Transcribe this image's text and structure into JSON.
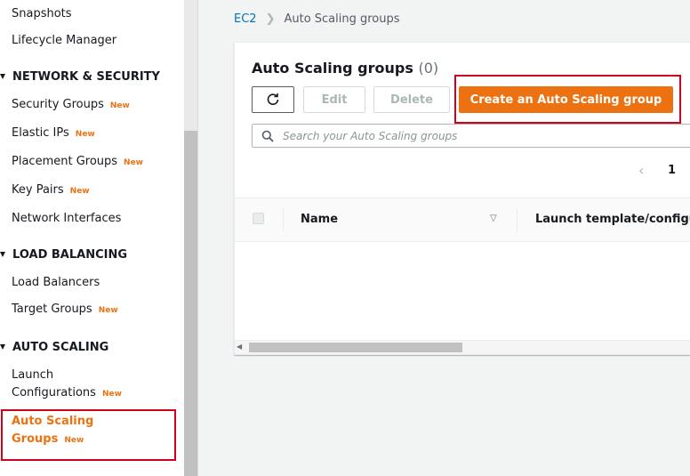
{
  "sidebar": {
    "items_top": [
      {
        "label": "Snapshots"
      },
      {
        "label": "Lifecycle Manager"
      }
    ],
    "network_section": "NETWORK & SECURITY",
    "network_items": [
      {
        "label": "Security Groups",
        "badge": "New"
      },
      {
        "label": "Elastic IPs",
        "badge": "New"
      },
      {
        "label": "Placement Groups",
        "badge": "New"
      },
      {
        "label": "Key Pairs",
        "badge": "New"
      },
      {
        "label": "Network Interfaces"
      }
    ],
    "lb_section": "LOAD BALANCING",
    "lb_items": [
      {
        "label": "Load Balancers"
      },
      {
        "label": "Target Groups",
        "badge": "New"
      }
    ],
    "as_section": "AUTO SCALING",
    "launch_configs": {
      "line1": "Launch",
      "line2": "Configurations",
      "badge": "New"
    },
    "auto_scaling_groups": {
      "line1": "Auto Scaling",
      "line2": "Groups",
      "badge": "New"
    }
  },
  "breadcrumb": {
    "root": "EC2",
    "current": "Auto Scaling groups"
  },
  "panel": {
    "title": "Auto Scaling groups",
    "count": "(0)",
    "buttons": {
      "edit": "Edit",
      "delete": "Delete",
      "create": "Create an Auto Scaling group"
    },
    "search_placeholder": "Search your Auto Scaling groups",
    "page": "1",
    "columns": {
      "name": "Name",
      "launch": "Launch template/configura"
    }
  },
  "colors": {
    "accent": "#ec7211",
    "link": "#0073bb",
    "highlight": "#d0021b"
  }
}
